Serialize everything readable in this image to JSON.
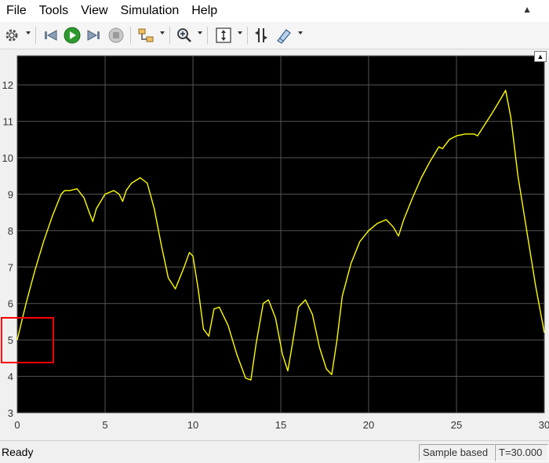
{
  "menu": {
    "items": [
      "File",
      "Tools",
      "View",
      "Simulation",
      "Help"
    ]
  },
  "toolbar": {
    "icons": [
      "gear-icon",
      "step-back-icon",
      "run-icon",
      "step-forward-icon",
      "stop-icon",
      "signal-selector-icon",
      "zoom-icon",
      "scale-axes-icon",
      "cursor-icon",
      "highlight-icon"
    ]
  },
  "status": {
    "ready": "Ready",
    "sample_label": "Sample based",
    "time_label": "T=30.000"
  },
  "colors": {
    "plot_bg": "#000000",
    "trace": "#ffff00",
    "grid": "#555555",
    "highlight_box": "#ff0000"
  },
  "chart_data": {
    "type": "line",
    "x": [
      0,
      0.5,
      1,
      1.5,
      2,
      2.5,
      2.7,
      3,
      3.4,
      3.8,
      4.1,
      4.3,
      4.5,
      5,
      5.5,
      5.8,
      6,
      6.2,
      6.5,
      7,
      7.4,
      7.8,
      8.2,
      8.6,
      9,
      9.5,
      9.8,
      10,
      10.3,
      10.6,
      10.9,
      11.2,
      11.5,
      12,
      12.5,
      13,
      13.3,
      13.6,
      14,
      14.3,
      14.7,
      15.1,
      15.4,
      15.7,
      16,
      16.4,
      16.8,
      17.2,
      17.6,
      17.9,
      18.2,
      18.5,
      19,
      19.5,
      20,
      20.5,
      21,
      21.4,
      21.7,
      22,
      22.5,
      23,
      23.5,
      24,
      24.2,
      24.6,
      25,
      25.5,
      26,
      26.2,
      26.6,
      27,
      27.5,
      27.8,
      28.1,
      28.5,
      29,
      29.5,
      30
    ],
    "y": [
      5.0,
      6.0,
      6.9,
      7.7,
      8.4,
      9.0,
      9.1,
      9.1,
      9.15,
      8.9,
      8.5,
      8.25,
      8.6,
      9.0,
      9.1,
      9.0,
      8.8,
      9.1,
      9.3,
      9.45,
      9.3,
      8.6,
      7.6,
      6.7,
      6.4,
      7.0,
      7.4,
      7.3,
      6.4,
      5.3,
      5.1,
      5.85,
      5.9,
      5.4,
      4.6,
      3.95,
      3.9,
      4.9,
      6.0,
      6.1,
      5.6,
      4.6,
      4.15,
      5.0,
      5.9,
      6.1,
      5.7,
      4.8,
      4.2,
      4.05,
      5.0,
      6.2,
      7.1,
      7.7,
      8.0,
      8.2,
      8.3,
      8.1,
      7.85,
      8.3,
      8.9,
      9.45,
      9.9,
      10.3,
      10.25,
      10.5,
      10.6,
      10.65,
      10.65,
      10.6,
      10.9,
      11.2,
      11.6,
      11.85,
      11.1,
      9.5,
      8.0,
      6.5,
      5.2
    ],
    "xlim": [
      0,
      30
    ],
    "ylim": [
      3,
      12.8
    ],
    "xticks": [
      "0",
      "5",
      "10",
      "15",
      "20",
      "25",
      "30"
    ],
    "yticks": [
      "3",
      "4",
      "5",
      "6",
      "7",
      "8",
      "9",
      "10",
      "11",
      "12"
    ],
    "grid": true
  }
}
